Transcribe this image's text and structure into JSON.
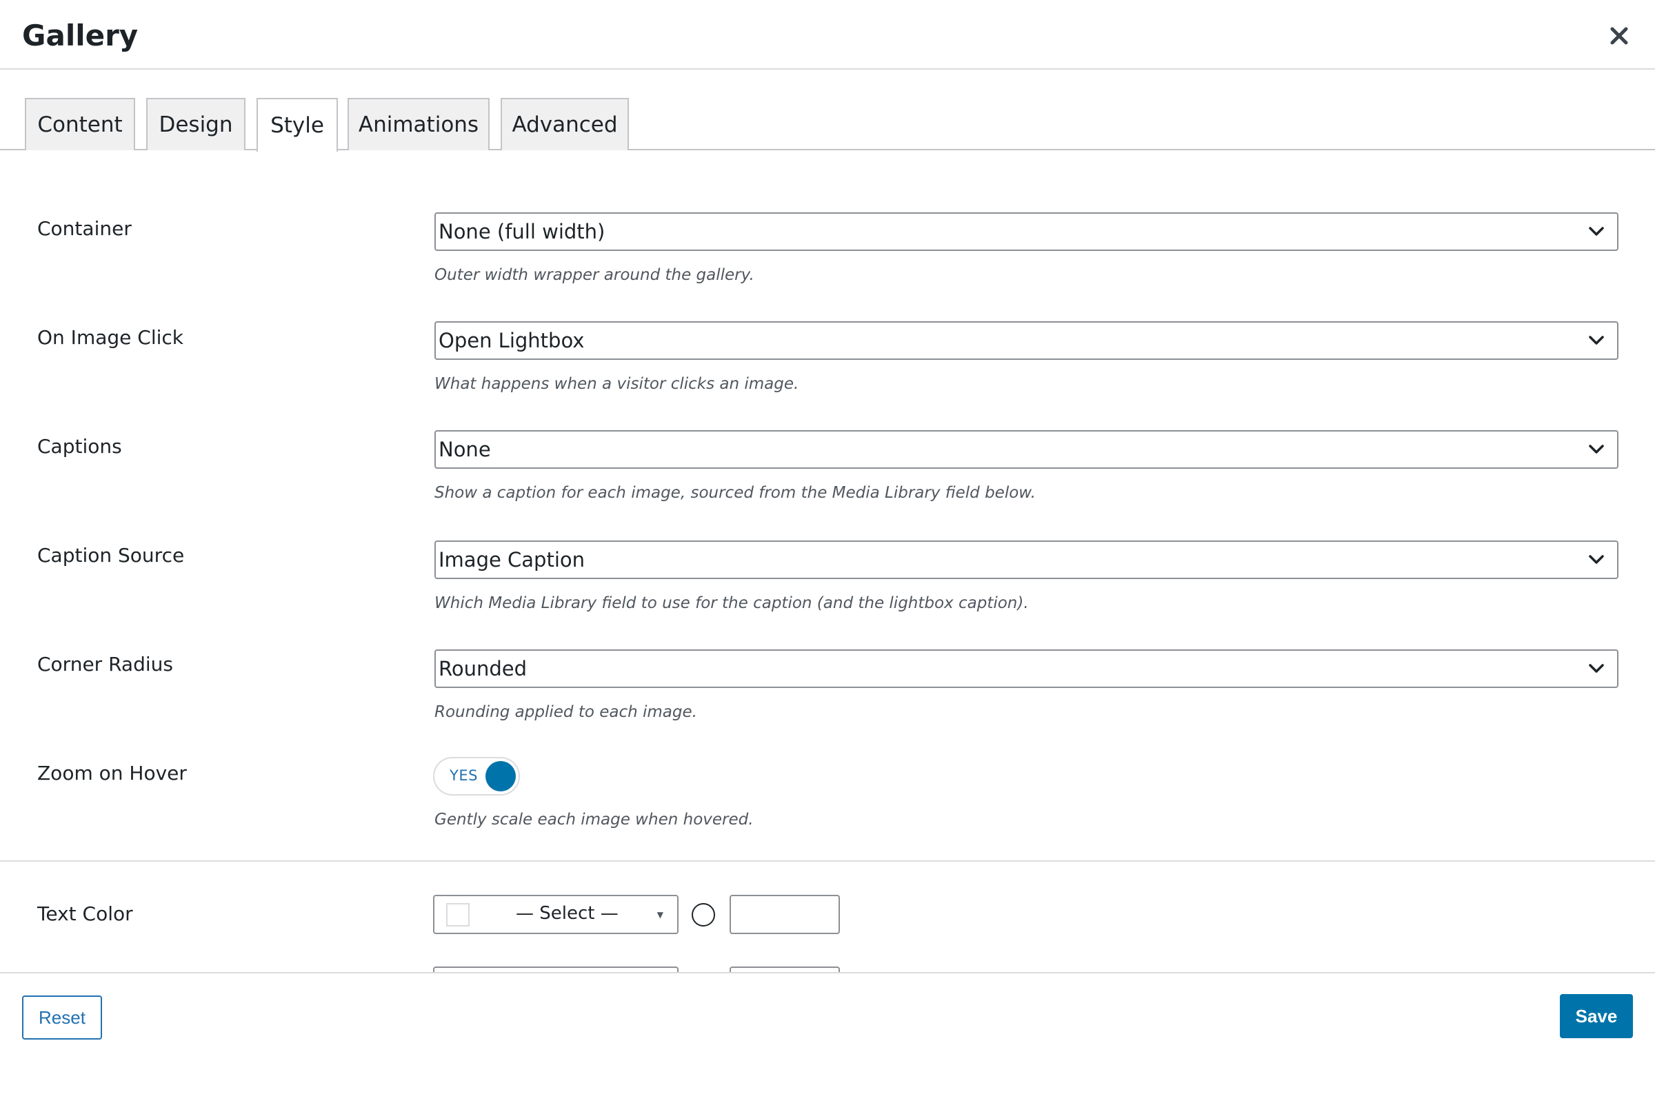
{
  "dialog": {
    "title": "Gallery",
    "close_icon": "close-icon"
  },
  "tabs": [
    {
      "label": "Content",
      "active": false
    },
    {
      "label": "Design",
      "active": false
    },
    {
      "label": "Style",
      "active": true
    },
    {
      "label": "Animations",
      "active": false
    },
    {
      "label": "Advanced",
      "active": false
    }
  ],
  "fields": {
    "container": {
      "label": "Container",
      "value": "None (full width)",
      "help": "Outer width wrapper around the gallery."
    },
    "on_image_click": {
      "label": "On Image Click",
      "value": "Open Lightbox",
      "help": "What happens when a visitor clicks an image."
    },
    "captions": {
      "label": "Captions",
      "value": "None",
      "help": "Show a caption for each image, sourced from the Media Library field below."
    },
    "caption_source": {
      "label": "Caption Source",
      "value": "Image Caption",
      "help": "Which Media Library field to use for the caption (and the lightbox caption)."
    },
    "corner_radius": {
      "label": "Corner Radius",
      "value": "Rounded",
      "help": "Rounding applied to each image."
    },
    "zoom_on_hover": {
      "label": "Zoom on Hover",
      "toggle_text": "YES",
      "enabled": true,
      "help": "Gently scale each image when hovered."
    },
    "text_color": {
      "label": "Text Color",
      "select_text": "— Select —",
      "value": ""
    }
  },
  "footer": {
    "reset_label": "Reset",
    "save_label": "Save"
  },
  "colors": {
    "accent": "#0073aa",
    "link": "#2271b1",
    "border": "#8c8f94",
    "divider": "#dcdcde",
    "tab_bg": "#f0f0f1",
    "help_text": "#50575e"
  }
}
